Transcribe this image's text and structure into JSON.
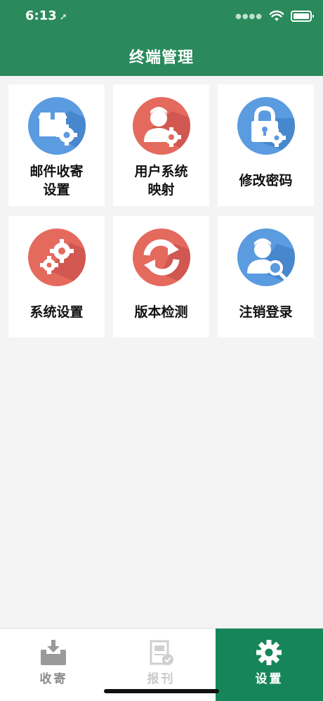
{
  "status_bar": {
    "time": "6:13"
  },
  "header": {
    "title": "终端管理"
  },
  "colors": {
    "header_bg": "#2a8a5c",
    "active_tab": "#16865a",
    "blue_icon": "#5b9be0",
    "red_icon": "#e46a5e"
  },
  "tiles": [
    {
      "line1": "邮件收寄",
      "line2": "设置",
      "icon": "package-gear-icon"
    },
    {
      "line1": "用户系统",
      "line2": "映射",
      "icon": "user-gear-icon"
    },
    {
      "line1": "修改密码",
      "line2": "",
      "icon": "lock-gear-icon"
    },
    {
      "line1": "系统设置",
      "line2": "",
      "icon": "gears-icon"
    },
    {
      "line1": "版本检测",
      "line2": "",
      "icon": "refresh-icon"
    },
    {
      "line1": "注销登录",
      "line2": "",
      "icon": "user-search-icon"
    }
  ],
  "tabs": [
    {
      "label": "收寄",
      "icon": "inbox-icon",
      "active": false
    },
    {
      "label": "报刊",
      "icon": "newspaper-icon",
      "active": false
    },
    {
      "label": "设置",
      "icon": "gear-icon",
      "active": true
    }
  ]
}
